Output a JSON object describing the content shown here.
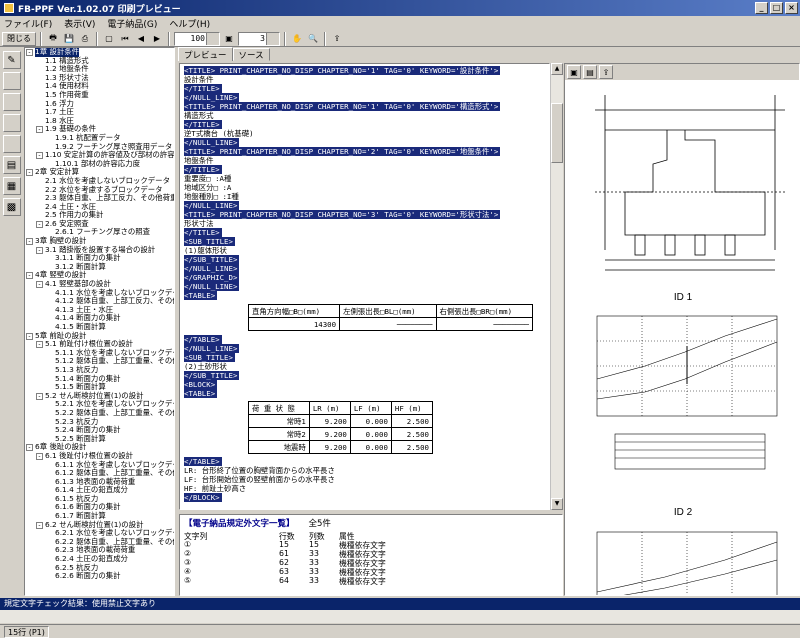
{
  "window": {
    "title": "FB-PPF Ver.1.02.07  印刷プレビュー"
  },
  "menu": [
    "ファイル(F)",
    "表示(V)",
    "電子納品(G)",
    "ヘルプ(H)"
  ],
  "toolbar": {
    "close_label": "閉じる",
    "zoom": "100",
    "page": "3"
  },
  "tree": [
    {
      "level": 0,
      "text": "1章 設計条件",
      "selected": true,
      "expander": "-"
    },
    {
      "level": 1,
      "text": "1.1 構造形式"
    },
    {
      "level": 1,
      "text": "1.2 地盤条件"
    },
    {
      "level": 1,
      "text": "1.3 形状寸法"
    },
    {
      "level": 1,
      "text": "1.4 使用材料"
    },
    {
      "level": 1,
      "text": "1.5 作用荷重"
    },
    {
      "level": 1,
      "text": "1.6 浮力"
    },
    {
      "level": 1,
      "text": "1.7 土圧"
    },
    {
      "level": 1,
      "text": "1.8 水圧"
    },
    {
      "level": 1,
      "text": "1.9 基礎の条件",
      "expander": "-"
    },
    {
      "level": 2,
      "text": "1.9.1 杭配置データ"
    },
    {
      "level": 2,
      "text": "1.9.2 フーチング厚さ照査用データ"
    },
    {
      "level": 1,
      "text": "1.10 安定計算の許容値及び部材の許容応力度",
      "expander": "-"
    },
    {
      "level": 2,
      "text": "1.10.1 部材の許容応力度"
    },
    {
      "level": 0,
      "text": "2章 安定計算",
      "expander": "-"
    },
    {
      "level": 1,
      "text": "2.1 水位を考慮しないブロックデータ"
    },
    {
      "level": 1,
      "text": "2.2 水位を考慮するブロックデータ"
    },
    {
      "level": 1,
      "text": "2.3 躯体自重、上部工反力、その他荷重"
    },
    {
      "level": 1,
      "text": "2.4 土圧・水圧"
    },
    {
      "level": 1,
      "text": "2.5 作用力の集計"
    },
    {
      "level": 1,
      "text": "2.6 安定照査",
      "expander": "-"
    },
    {
      "level": 2,
      "text": "2.6.1 フーチング厚さの照査"
    },
    {
      "level": 0,
      "text": "3章 胸壁の設計",
      "expander": "-"
    },
    {
      "level": 1,
      "text": "3.1 踏掛版を設置する場合の設計",
      "expander": "-"
    },
    {
      "level": 2,
      "text": "3.1.1 断面力の集計"
    },
    {
      "level": 2,
      "text": "3.1.2 断面計算"
    },
    {
      "level": 0,
      "text": "4章 竪壁の設計",
      "expander": "-"
    },
    {
      "level": 1,
      "text": "4.1 竪壁基部の設計",
      "expander": "-"
    },
    {
      "level": 2,
      "text": "4.1.1 水位を考慮しないブロックデータ"
    },
    {
      "level": 2,
      "text": "4.1.2 躯体自重、上部工反力、その他"
    },
    {
      "level": 2,
      "text": "4.1.3 土圧・水圧"
    },
    {
      "level": 2,
      "text": "4.1.4 断面力の集計"
    },
    {
      "level": 2,
      "text": "4.1.5 断面計算"
    },
    {
      "level": 0,
      "text": "5章 前趾の設計",
      "expander": "-"
    },
    {
      "level": 1,
      "text": "5.1 前趾付け根位置の設計",
      "expander": "-"
    },
    {
      "level": 2,
      "text": "5.1.1 水位を考慮しないブロックデータ"
    },
    {
      "level": 2,
      "text": "5.1.2 躯体自重、上部工重量、その他"
    },
    {
      "level": 2,
      "text": "5.1.3 杭反力"
    },
    {
      "level": 2,
      "text": "5.1.4 断面力の集計"
    },
    {
      "level": 2,
      "text": "5.1.5 断面計算"
    },
    {
      "level": 1,
      "text": "5.2 せん断検討位置(1)の設計",
      "expander": "-"
    },
    {
      "level": 2,
      "text": "5.2.1 水位を考慮しないブロックデータ"
    },
    {
      "level": 2,
      "text": "5.2.2 躯体自重、上部工重量、その他"
    },
    {
      "level": 2,
      "text": "5.2.3 杭反力"
    },
    {
      "level": 2,
      "text": "5.2.4 断面力の集計"
    },
    {
      "level": 2,
      "text": "5.2.5 断面計算"
    },
    {
      "level": 0,
      "text": "6章 後趾の設計",
      "expander": "-"
    },
    {
      "level": 1,
      "text": "6.1 後趾付け根位置の設計",
      "expander": "-"
    },
    {
      "level": 2,
      "text": "6.1.1 水位を考慮しないブロックデータ"
    },
    {
      "level": 2,
      "text": "6.1.2 躯体自重、上部工重量、その他"
    },
    {
      "level": 2,
      "text": "6.1.3 地表面の載荷荷重"
    },
    {
      "level": 2,
      "text": "6.1.4 土圧の鉛直成分"
    },
    {
      "level": 2,
      "text": "6.1.5 杭反力"
    },
    {
      "level": 2,
      "text": "6.1.6 断面力の集計"
    },
    {
      "level": 2,
      "text": "6.1.7 断面計算"
    },
    {
      "level": 1,
      "text": "6.2 せん断検討位置(1)の設計",
      "expander": "-"
    },
    {
      "level": 2,
      "text": "6.2.1 水位を考慮しないブロックデータ"
    },
    {
      "level": 2,
      "text": "6.2.2 躯体自重、上部工重量、その他"
    },
    {
      "level": 2,
      "text": "6.2.3 地表面の載荷荷重"
    },
    {
      "level": 2,
      "text": "6.2.4 土圧の鉛直成分"
    },
    {
      "level": 2,
      "text": "6.2.5 杭反力"
    },
    {
      "level": 2,
      "text": "6.2.6 断面力の集計"
    }
  ],
  "tabs": [
    "プレビュー",
    "ソース"
  ],
  "source_lines": [
    {
      "t": "<TITLE> PRINT_CHAPTER_NO_DISP CHAPTER_NO='1' TAG='0' KEYWORD='設計条件'>",
      "hl": true
    },
    {
      "t": "設計条件",
      "hl": false
    },
    {
      "t": "</TITLE>",
      "hl": true
    },
    {
      "t": "</NULL_LINE>",
      "hl": true
    },
    {
      "t": "<TITLE> PRINT_CHAPTER_NO_DISP CHAPTER_NO='1' TAG='0' KEYWORD='構造形式'>",
      "hl": true
    },
    {
      "t": "構造形式",
      "hl": false
    },
    {
      "t": "</TITLE>",
      "hl": true
    },
    {
      "t": "  逆T式橋台 (杭基礎)",
      "hl": false
    },
    {
      "t": "</NULL_LINE>",
      "hl": true
    },
    {
      "t": "<TITLE> PRINT_CHAPTER_NO_DISP CHAPTER_NO='2' TAG='0' KEYWORD='地盤条件'>",
      "hl": true
    },
    {
      "t": "地盤条件",
      "hl": false
    },
    {
      "t": "</TITLE>",
      "hl": true
    },
    {
      "t": "重要度□ :A種",
      "hl": false
    },
    {
      "t": "地域区分□ :A",
      "hl": false
    },
    {
      "t": "地盤種別□ :I種",
      "hl": false
    },
    {
      "t": "</NULL_LINE>",
      "hl": true
    },
    {
      "t": "<TITLE> PRINT_CHAPTER_NO_DISP CHAPTER_NO='3' TAG='0' KEYWORD='形状寸法'>",
      "hl": true
    },
    {
      "t": "形状寸法",
      "hl": false
    },
    {
      "t": "</TITLE>",
      "hl": true
    },
    {
      "t": "<SUB_TITLE>",
      "hl": true
    },
    {
      "t": "(1)躯体形状",
      "hl": false
    },
    {
      "t": "</SUB_TITLE>",
      "hl": true
    },
    {
      "t": "</NULL_LINE>",
      "hl": true
    },
    {
      "t": "</GRAPHIC_D>",
      "hl": true
    },
    {
      "t": "</NULL_LINE>",
      "hl": true
    },
    {
      "t": "<TABLE>",
      "hl": true
    }
  ],
  "table1": {
    "headers": [
      "直角方向幅□B□(mm)",
      "左側張出長□BL□(mm)",
      "右側張出長□BR□(mm)"
    ],
    "values": [
      "14300",
      "────────",
      "────────"
    ]
  },
  "source_lines2": [
    {
      "t": "</TABLE>",
      "hl": true
    },
    {
      "t": "</NULL_LINE>",
      "hl": true
    },
    {
      "t": "<SUB_TITLE>",
      "hl": true
    },
    {
      "t": "(2)土砂形状",
      "hl": false
    },
    {
      "t": "</SUB_TITLE>",
      "hl": true
    },
    {
      "t": "<BLOCK>",
      "hl": true
    },
    {
      "t": "<TABLE>",
      "hl": true
    }
  ],
  "table2": {
    "headers": [
      "荷 重 状 態",
      "LR (m)",
      "LF (m)",
      "HF (m)"
    ],
    "rows": [
      [
        "常時1",
        "9.200",
        "0.000",
        "2.500"
      ],
      [
        "常時2",
        "9.200",
        "0.000",
        "2.500"
      ],
      [
        "地震時",
        "9.200",
        "0.000",
        "2.500"
      ]
    ]
  },
  "source_lines3": [
    {
      "t": "</TABLE>",
      "hl": true
    },
    {
      "t": "    LR: 台形終了位置の胸壁背面からの水平長さ",
      "hl": false
    },
    {
      "t": "    LF: 台形開始位置の竪壁前面からの水平長さ",
      "hl": false
    },
    {
      "t": "    HF: 前趾土砂高さ",
      "hl": false
    },
    {
      "t": "</BLOCK>",
      "hl": true
    }
  ],
  "errors": {
    "title": "【電子納品規定外文字一覧】",
    "count": "全5件",
    "headers": [
      "文字列",
      "行数",
      "列数",
      "属性"
    ],
    "rows": [
      [
        "①",
        "15",
        "15",
        "機種依存文字"
      ],
      [
        "②",
        "61",
        "33",
        "機種依存文字"
      ],
      [
        "③",
        "62",
        "33",
        "機種依存文字"
      ],
      [
        "④",
        "63",
        "33",
        "機種依存文字"
      ],
      [
        "⑤",
        "64",
        "33",
        "機種依存文字"
      ]
    ]
  },
  "preview": {
    "id1": "ID 1",
    "id2": "ID 2"
  },
  "status": {
    "message": "規定文字チェック結果：使用禁止文字あり",
    "position": "15行 (P1)"
  }
}
